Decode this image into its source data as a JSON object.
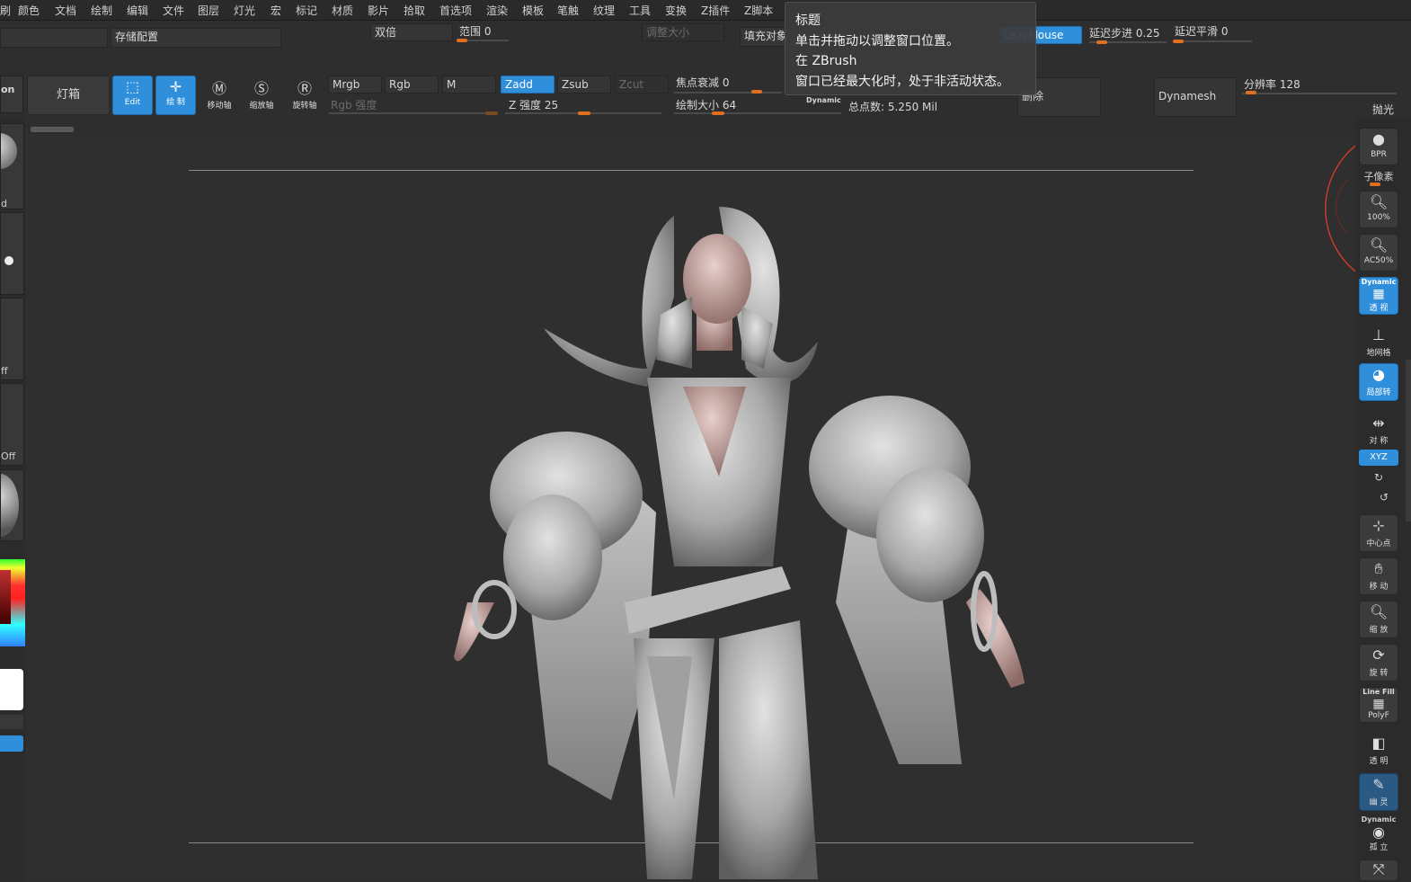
{
  "menu": [
    "颜色",
    "文档",
    "绘制",
    "编辑",
    "文件",
    "图层",
    "灯光",
    "宏",
    "标记",
    "材质",
    "影片",
    "拾取",
    "首选项",
    "渲染",
    "模板",
    "笔触",
    "纹理",
    "工具",
    "变换",
    "Z插件",
    "Z脚本"
  ],
  "menu_partial": "刷",
  "top": {
    "store_config": "存储配置",
    "double": "双倍",
    "range": "范围 0",
    "resize": "调整大小",
    "fill_object": "填充对象",
    "lazymouse": "LazyMouse",
    "lazy_step": "延迟步进 0.25",
    "lazy_smooth": "延迟平滑 0"
  },
  "toolbar": {
    "partial_left": "on",
    "lightbox": "灯箱",
    "edit": "Edit",
    "draw": "绘 制",
    "move": "移动轴",
    "scale": "缩放轴",
    "rotate": "旋转轴",
    "mrgb": "Mrgb",
    "rgb": "Rgb",
    "m": "M",
    "zadd": "Zadd",
    "zsub": "Zsub",
    "zcut": "Zcut",
    "rgb_intensity": "Rgb 强度",
    "z_intensity": "Z 强度 25",
    "focal_shift": "焦点衰减 0",
    "draw_size": "绘制大小 64",
    "dynamic": "Dynamic",
    "total_points": "总点数: 5.250 Mil",
    "delete": "删除",
    "dynamesh": "Dynamesh",
    "resolution": "分辨率 128",
    "polish": "抛光"
  },
  "tooltip": {
    "title": "标题",
    "line1": "单击并拖动以调整窗口位置。",
    "line2": "在 ZBrush",
    "line3": "窗口已经最大化时，处于非活动状态。"
  },
  "left_panel": {
    "d": "d",
    "ff": "ff",
    "off": "Off"
  },
  "right_panel": {
    "bpr": "BPR",
    "subpixel": "子像素",
    "zoom100": "100%",
    "ac50": "AC50%",
    "dynamic_label": "Dynamic",
    "perspective": "透 视",
    "floor": "地网格",
    "local": "局部转",
    "symmetry": "对 称",
    "xyz": "XYZ",
    "center": "中心点",
    "move": "移 动",
    "zoom": "缩 放",
    "rotate": "旋 转",
    "linefill": "Line Fill",
    "polyf": "PolyF",
    "transparent": "透 明",
    "ghost": "幽 灵",
    "dynamic2": "Dynamic",
    "solo": "孤 立"
  },
  "colors": {
    "accent_blue": "#2f8fdb",
    "slider_orange": "#e0701f",
    "background": "#2f2f2f"
  }
}
